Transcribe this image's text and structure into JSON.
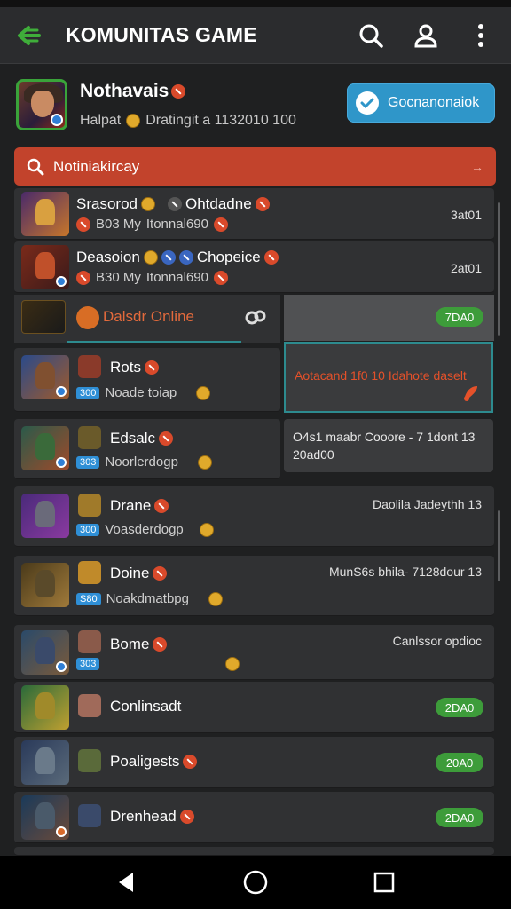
{
  "header": {
    "title": "KOMUNITAS GAME",
    "icons": [
      "back-arrow-icon",
      "search-icon",
      "user-icon",
      "more-vert-icon"
    ]
  },
  "profile": {
    "name": "Nothavais",
    "subtitle_a": "Halpat",
    "subtitle_b": "Dratingit a 1132010 100"
  },
  "connect": {
    "label": "Gocnanonaiok"
  },
  "search": {
    "placeholder": "Notiniakircay",
    "arrow": "→"
  },
  "rows": [
    {
      "name": "Srasorod",
      "name2": "Ohtdadne",
      "sub": "B03 My",
      "sub2": "Itonnal690",
      "right": "3at01"
    },
    {
      "name": "Deasoion",
      "name2": "Chopeice",
      "sub": "B30 My",
      "sub2": "Itonnal690",
      "right": "2at01"
    },
    {
      "name": "Dalsdr Online",
      "button": "7DA0"
    },
    {
      "name": "Rots",
      "sub_pill": "300",
      "sub": "Noade toiap"
    },
    {
      "name": "Edsalc",
      "sub_pill": "303",
      "sub": "Noorlerdogp"
    },
    {
      "name": "Drane",
      "sub_pill": "300",
      "sub": "Voasderdogp",
      "right": "Daolila Jadeythh 13"
    },
    {
      "name": "Doine",
      "sub_pill": "S80",
      "sub": "Noakdmatbpg",
      "right": "MunS6s bhila- 7128dour 13"
    },
    {
      "name": "Bome",
      "sub_pill": "303",
      "right": "Canlssor opdioc"
    },
    {
      "name": "Conlinsadt",
      "button": "2DA0"
    },
    {
      "name": "Poaligests",
      "button": "20A0"
    },
    {
      "name": "Drenhead",
      "button": "2DA0"
    }
  ],
  "notification": {
    "text": "Aotacand 1f0 10 Idahote daselt"
  },
  "message": {
    "line1": "O4s1 maabr Cooore - 7 1dont 13",
    "line2": "20ad00"
  },
  "colors": {
    "accent_red": "#c2432c",
    "accent_blue": "#2f96c9",
    "accent_green": "#3d9c3a",
    "teal": "#2d8b8f"
  },
  "nav": [
    "back-triangle-icon",
    "home-circle-icon",
    "recents-square-icon"
  ]
}
